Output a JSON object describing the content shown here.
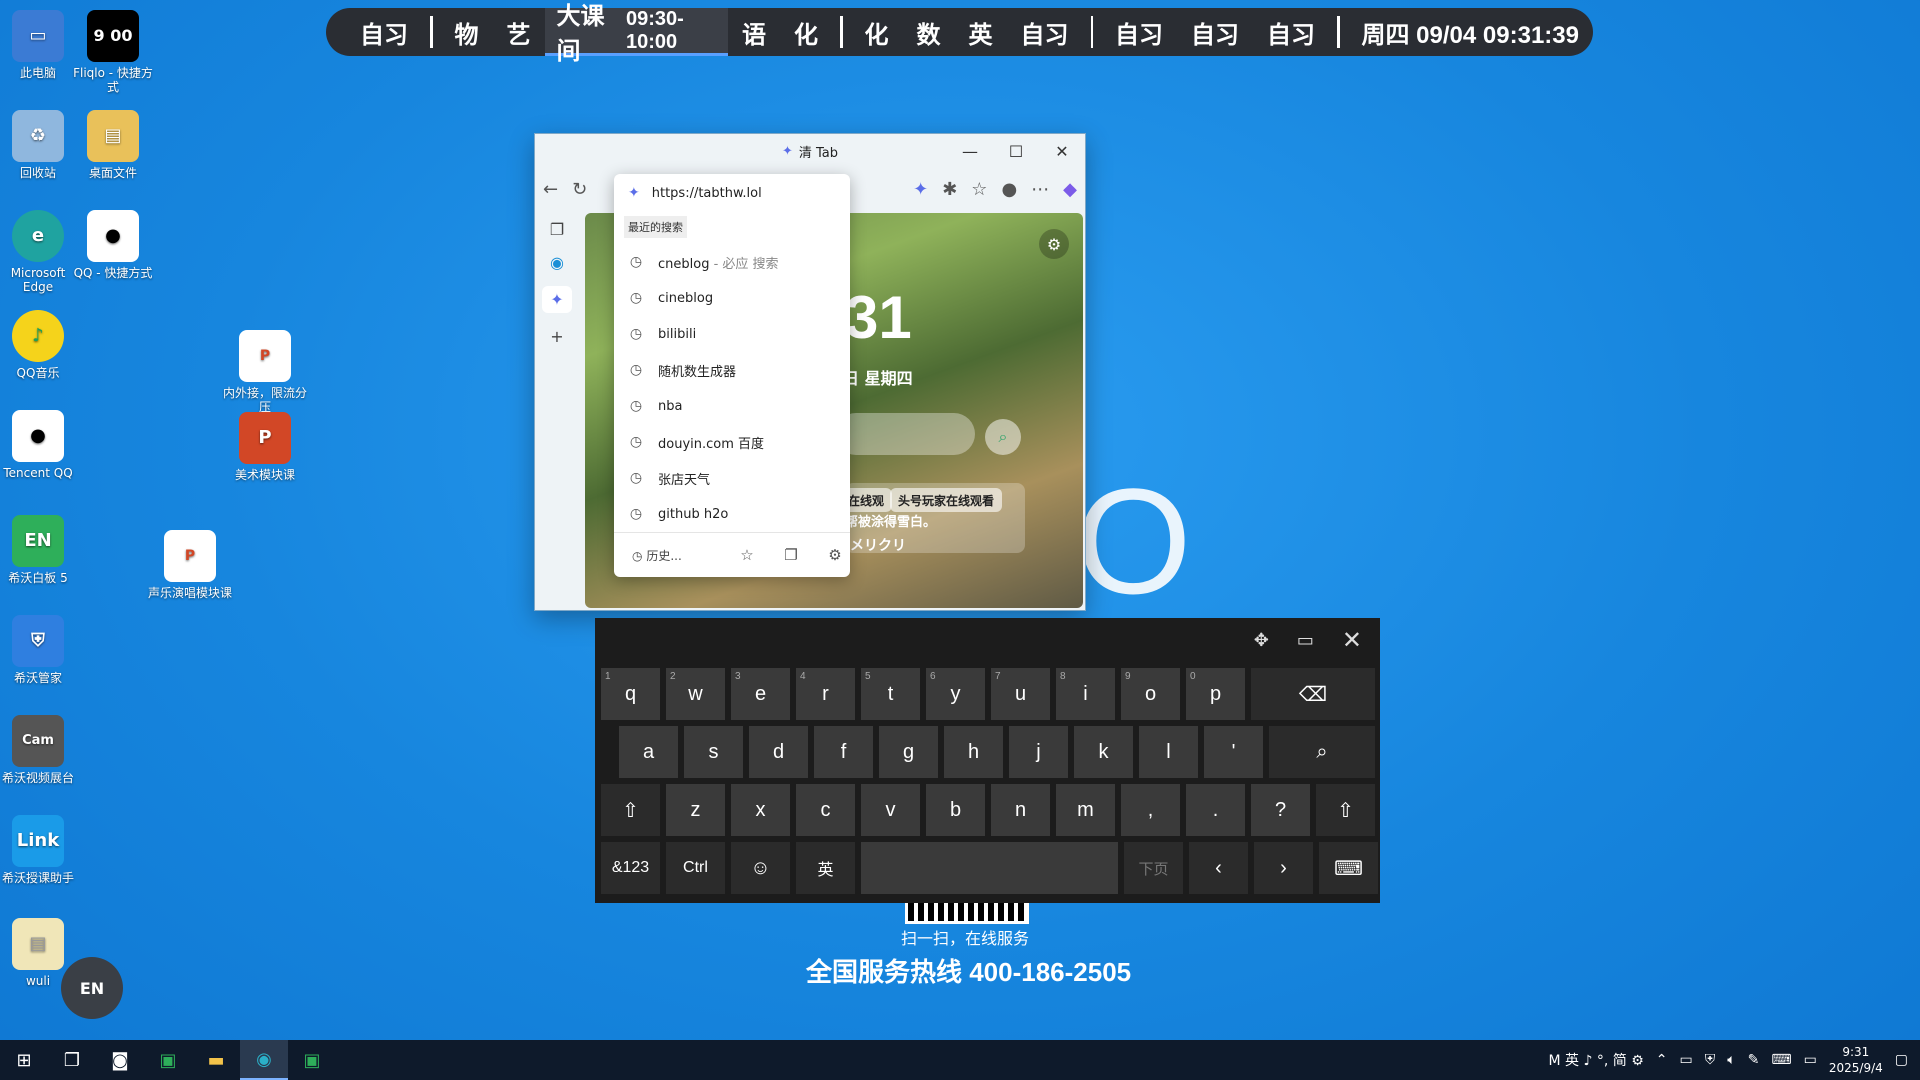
{
  "schedule": {
    "items": [
      "自习",
      "物",
      "艺",
      "语",
      "化",
      "化",
      "数",
      "英",
      "自习",
      "自习",
      "自习",
      "自习"
    ],
    "current_label": "大课间",
    "current_time": "09:30-10:00",
    "date_time": "周四 09/04  09:31:39"
  },
  "desktop_icons": [
    {
      "label": "此电脑"
    },
    {
      "label": "Fliqlo - 快捷方式"
    },
    {
      "label": "回收站"
    },
    {
      "label": "桌面文件"
    },
    {
      "label": "Microsoft Edge"
    },
    {
      "label": "QQ - 快捷方式"
    },
    {
      "label": "QQ音乐"
    },
    {
      "label": "内外接，限流分压"
    },
    {
      "label": "Tencent QQ"
    },
    {
      "label": "美术模块课"
    },
    {
      "label": "希沃白板 5"
    },
    {
      "label": "声乐演唱模块课"
    },
    {
      "label": "希沃管家"
    },
    {
      "label": "希沃视频展台"
    },
    {
      "label": "希沃授课助手"
    },
    {
      "label": "wuli"
    }
  ],
  "fliqlo_time": "9 00",
  "browser": {
    "title": "清 Tab",
    "page_clock": "31",
    "page_date": "日 星期四",
    "chip1": "在线观",
    "chip2": "头号玩家在线观看",
    "sub1": "帮被涂得雪白。",
    "sub2": "メリクリ"
  },
  "address_dropdown": {
    "url": "https://tabthw.lol",
    "header": "最近的搜索",
    "items": [
      {
        "text": "cneblog",
        "suffix": " - 必应 搜索"
      },
      {
        "text": "cineblog",
        "suffix": ""
      },
      {
        "text": "bilibili",
        "suffix": ""
      },
      {
        "text": "随机数生成器",
        "suffix": ""
      },
      {
        "text": "nba",
        "suffix": ""
      },
      {
        "text": "douyin.com 百度",
        "suffix": ""
      },
      {
        "text": "张店天气",
        "suffix": ""
      },
      {
        "text": "github h2o",
        "suffix": ""
      }
    ],
    "history_label": "历史..."
  },
  "keyboard": {
    "row1": [
      [
        "q",
        "1"
      ],
      [
        "w",
        "2"
      ],
      [
        "e",
        "3"
      ],
      [
        "r",
        "4"
      ],
      [
        "t",
        "5"
      ],
      [
        "y",
        "6"
      ],
      [
        "u",
        "7"
      ],
      [
        "i",
        "8"
      ],
      [
        "o",
        "9"
      ],
      [
        "p",
        "0"
      ]
    ],
    "row2": [
      "a",
      "s",
      "d",
      "f",
      "g",
      "h",
      "j",
      "k",
      "l",
      "'"
    ],
    "row3": [
      "z",
      "x",
      "c",
      "v",
      "b",
      "n",
      "m",
      ",",
      ".",
      "?"
    ],
    "sym": "&123",
    "ctrl": "Ctrl",
    "lang": "英",
    "page_down": "下页"
  },
  "background": {
    "big_letter": "O",
    "scan_text": "扫一扫，在线服务",
    "hotline": "全国服务热线 400-186-2505"
  },
  "en_float": "EN",
  "taskbar": {
    "tray_ime": "M 英 ♪ °, 简 ⚙",
    "time": "9:31",
    "date": "2025/9/4"
  }
}
